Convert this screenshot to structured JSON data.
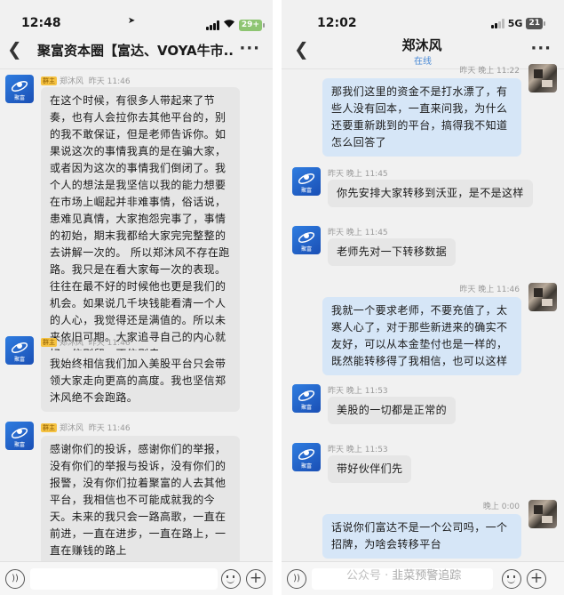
{
  "left_phone": {
    "status": {
      "time": "12:48",
      "battery": "29+"
    },
    "header": {
      "title": "聚富资本圈【富达、VOYA牛市..."
    },
    "avatar_label": "聚富",
    "messages": [
      {
        "tag": "群主",
        "sender": "郑沐风",
        "time": "昨天 11:46",
        "text": "在这个时候，有很多人带起来了节奏，也有人会拉你去其他平台的，别的我不敢保证，但是老师告诉你。如果说这次的事情我真的是在骗大家，或者因为这次的事情我们倒闭了。我个人的想法是我坚信以我的能力想要在市场上崛起并非难事情，俗话说，患难见真情，大家抱怨完事了，事情的初始，期末我都给大家完完整整的去讲解一次的。 所以郑沐风不存在跑路。我只是在看大家每一次的表现。往往在最不好的时候他也更是我们的机会。如果说几千块钱能看清一个人的人心，我觉得还是满值的。所以未来依旧可期。大家追寻自己的内心就好，信则留。不信则走"
      },
      {
        "tag": "群主",
        "sender": "郑沐风",
        "time": "昨天 11:46",
        "text": "我始终相信我们加入美股平台只会带领大家走向更高的高度。我也坚信郑沐风绝不会跑路。"
      },
      {
        "tag": "群主",
        "sender": "郑沐风",
        "time": "昨天 11:46",
        "text": "感谢你们的投诉，感谢你们的举报，没有你们的举报与投诉，没有你们的报警，没有你们拉着聚富的人去其他平台，我相信也不可能成就我的今天。未来的我只会一路高歌，一直在前进，一直在进步，一直在路上，一直在赚钱的路上"
      }
    ]
  },
  "right_phone": {
    "status": {
      "time": "12:02",
      "network": "5G",
      "battery": "21"
    },
    "header": {
      "title": "郑沐风",
      "subtitle": "在线"
    },
    "avatar_label": "聚富",
    "messages": [
      {
        "side": "out",
        "time": "昨天 晚上 11:22",
        "text": "那我们这里的资金不是打水漂了，有些人没有回本，一直来问我，为什么还要重新跳到的平台，搞得我不知道怎么回答了"
      },
      {
        "side": "in",
        "time": "昨天 晚上 11:45",
        "text": "你先安排大家转移到沃亚，是不是这样"
      },
      {
        "side": "in",
        "time": "昨天 晚上 11:45",
        "text": "老师先对一下转移数据"
      },
      {
        "side": "out",
        "time": "昨天 晚上 11:46",
        "text": "我就一个要求老师，不要充值了，太寒人心了，对于那些新进来的确实不友好，可以从本金垫付也是一样的，既然能转移得了我相信，也可以这样"
      },
      {
        "side": "in",
        "time": "昨天 晚上 11:53",
        "text": "美股的一切都是正常的"
      },
      {
        "side": "in",
        "time": "昨天 晚上 11:53",
        "text": "带好伙伴们先"
      },
      {
        "side": "out",
        "time": "晚上 0:00",
        "text": "话说你们富达不是一个公司吗，一个招牌，为啥会转移平台"
      }
    ]
  },
  "watermark": {
    "prefix": "公众号 ·",
    "text": "韭菜预警追踪"
  }
}
